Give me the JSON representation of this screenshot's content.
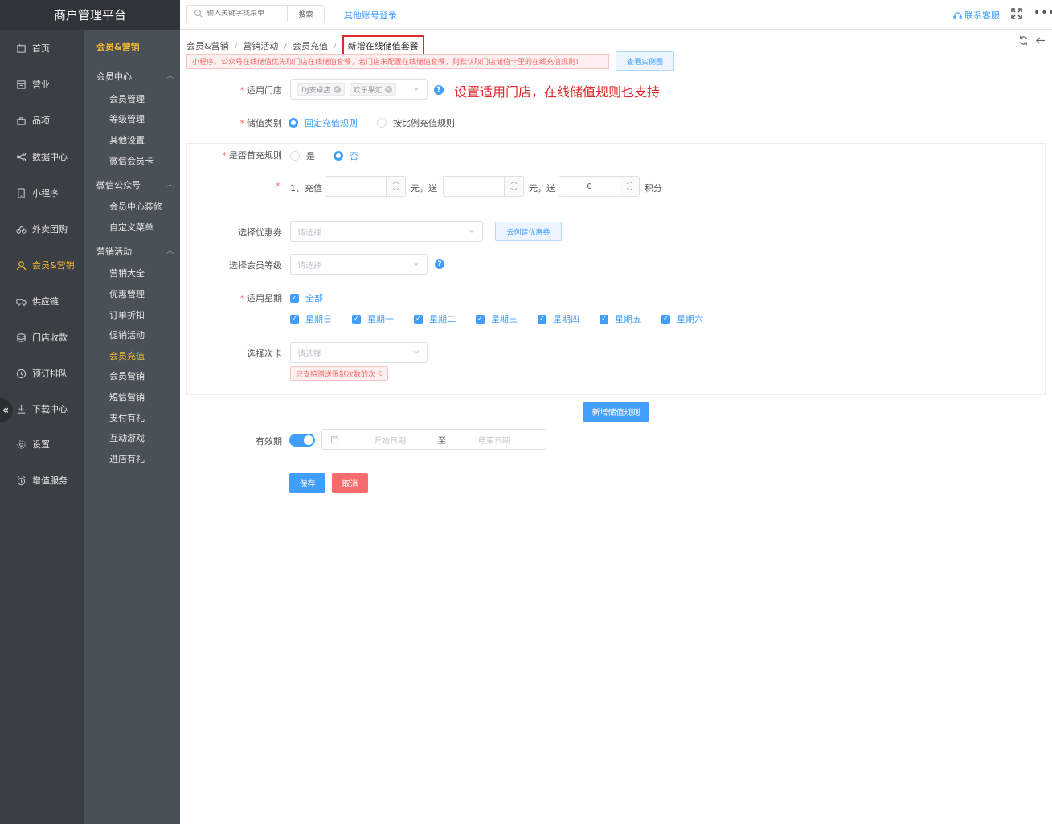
{
  "app": {
    "title": "商户管理平台"
  },
  "topbar": {
    "search_placeholder": "输入关键字找菜单",
    "search_button": "搜索",
    "other_login": "其他账号登录",
    "service": "联系客服",
    "more": "•••"
  },
  "sidebar": {
    "collapse": "«",
    "items": [
      {
        "label": "首页",
        "icon": "home-icon"
      },
      {
        "label": "营业",
        "icon": "calendar-icon"
      },
      {
        "label": "品项",
        "icon": "bag-icon"
      },
      {
        "label": "数据中心",
        "icon": "share-icon"
      },
      {
        "label": "小程序",
        "icon": "phone-icon"
      },
      {
        "label": "外卖团购",
        "icon": "bike-icon"
      },
      {
        "label": "会员&营销",
        "icon": "user-icon"
      },
      {
        "label": "供应链",
        "icon": "truck-icon"
      },
      {
        "label": "门店收款",
        "icon": "coins-icon"
      },
      {
        "label": "预订排队",
        "icon": "clock-icon"
      },
      {
        "label": "下载中心",
        "icon": "download-icon"
      },
      {
        "label": "设置",
        "icon": "gear-icon"
      },
      {
        "label": "增值服务",
        "icon": "alarm-icon"
      }
    ]
  },
  "subnav": {
    "header": "会员&营销",
    "groups": [
      {
        "label": "会员中心",
        "items": [
          "会员管理",
          "等级管理",
          "其他设置",
          "微信会员卡"
        ]
      },
      {
        "label": "微信公众号",
        "items": [
          "会员中心装修",
          "自定义菜单"
        ]
      },
      {
        "label": "营销活动",
        "items": [
          "营销大全",
          "优惠管理",
          "订单折扣",
          "促销活动",
          "会员充值",
          "会员营销",
          "短信营销",
          "支付有礼",
          "互动游戏",
          "进店有礼"
        ]
      }
    ]
  },
  "breadcrumb": [
    "会员&营销",
    "营销活动",
    "会员充值",
    "新增在线储值套餐"
  ],
  "notice": "小程序、公众号在线储值优先取门店在线储值套餐，若门店未配置在线储值套餐，则默认取门店储值卡里的在线充值规则！",
  "example_button": "查看实例图",
  "annotation": "设置适用门店，在线储值规则也支持",
  "form": {
    "stores_label": "适用门店",
    "stores": [
      "DJ安卓店",
      "欢乐果汇"
    ],
    "type_label": "储值类别",
    "type_options": [
      "固定充值规则",
      "按比例充值规则"
    ],
    "first_label": "是否首充规则",
    "first_options": [
      "是",
      "否"
    ],
    "rule_prefix": "1、充值",
    "yuan_send": "元，送",
    "points_value": "0",
    "points_unit": "积分",
    "coupon_label": "选择优惠券",
    "coupon_placeholder": "请选择",
    "create_coupon": "去创建优惠券",
    "level_label": "选择会员等级",
    "level_placeholder": "请选择",
    "weekday_label": "适用星期",
    "all_label": "全部",
    "weekdays": [
      "星期日",
      "星期一",
      "星期二",
      "星期三",
      "星期四",
      "星期五",
      "星期六"
    ],
    "card_label": "选择次卡",
    "card_placeholder": "请选择",
    "card_warning": "只支持赠送限制次数的次卡",
    "add_rule": "新增储值规则",
    "validity_label": "有效期",
    "start_placeholder": "开始日期",
    "to": "至",
    "end_placeholder": "结束日期",
    "save": "保存",
    "cancel": "取消"
  },
  "colors": {
    "primary": "#409eff",
    "danger": "#f56c6c",
    "accent": "#f5b82e",
    "sidebar": "#3a3f45"
  }
}
